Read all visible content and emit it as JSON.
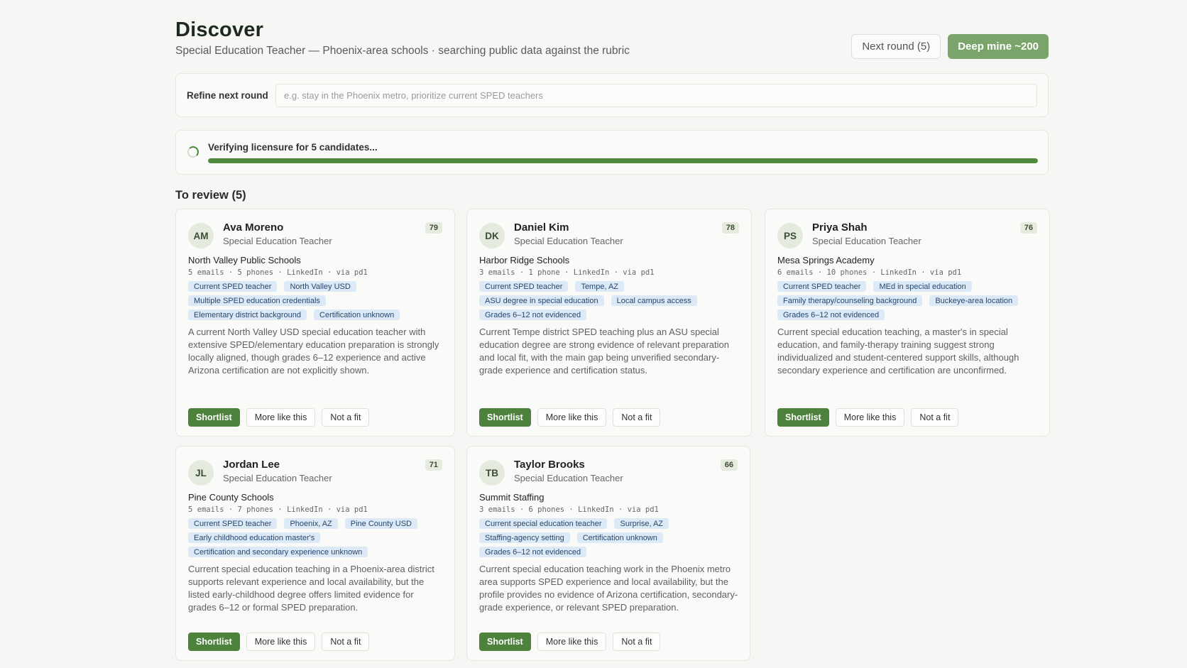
{
  "header": {
    "title": "Discover",
    "subtitle": "Special Education Teacher — Phoenix-area schools · searching public data against the rubric",
    "next_round_label": "Next round (5)",
    "deep_mine_label": "Deep mine ~200"
  },
  "refine": {
    "label": "Refine next round",
    "placeholder": "e.g. stay in the Phoenix metro, prioritize current SPED teachers"
  },
  "progress": {
    "text": "Verifying licensure for 5 candidates...",
    "percent": 100
  },
  "review": {
    "title": "To review (5)",
    "actions": {
      "shortlist": "Shortlist",
      "more_like": "More like this",
      "not_fit": "Not a fit"
    },
    "candidates": [
      {
        "initials": "AM",
        "name": "Ava Moreno",
        "role": "Special Education Teacher",
        "score": "79",
        "org": "North Valley Public Schools",
        "meta": "5 emails · 5 phones · LinkedIn · via pd1",
        "tags": [
          "Current SPED teacher",
          "North Valley USD",
          "Multiple SPED education credentials",
          "Elementary district background",
          "Certification unknown"
        ],
        "summary": "A current North Valley USD special education teacher with extensive SPED/elementary education preparation is strongly locally aligned, though grades 6–12 experience and active Arizona certification are not explicitly shown."
      },
      {
        "initials": "DK",
        "name": "Daniel Kim",
        "role": "Special Education Teacher",
        "score": "78",
        "org": "Harbor Ridge Schools",
        "meta": "3 emails · 1 phone · LinkedIn · via pd1",
        "tags": [
          "Current SPED teacher",
          "Tempe, AZ",
          "ASU degree in special education",
          "Local campus access",
          "Grades 6–12 not evidenced"
        ],
        "summary": "Current Tempe district SPED teaching plus an ASU special education degree are strong evidence of relevant preparation and local fit, with the main gap being unverified secondary-grade experience and certification status."
      },
      {
        "initials": "PS",
        "name": "Priya Shah",
        "role": "Special Education Teacher",
        "score": "76",
        "org": "Mesa Springs Academy",
        "meta": "6 emails · 10 phones · LinkedIn · via pd1",
        "tags": [
          "Current SPED teacher",
          "MEd in special education",
          "Family therapy/counseling background",
          "Buckeye-area location",
          "Grades 6–12 not evidenced"
        ],
        "summary": "Current special education teaching, a master's in special education, and family-therapy training suggest strong individualized and student-centered support skills, although secondary experience and certification are unconfirmed."
      },
      {
        "initials": "JL",
        "name": "Jordan Lee",
        "role": "Special Education Teacher",
        "score": "71",
        "org": "Pine County Schools",
        "meta": "5 emails · 7 phones · LinkedIn · via pd1",
        "tags": [
          "Current SPED teacher",
          "Phoenix, AZ",
          "Pine County USD",
          "Early childhood education master's",
          "Certification and secondary experience unknown"
        ],
        "summary": "Current special education teaching in a Phoenix-area district supports relevant experience and local availability, but the listed early-childhood degree offers limited evidence for grades 6–12 or formal SPED preparation."
      },
      {
        "initials": "TB",
        "name": "Taylor Brooks",
        "role": "Special Education Teacher",
        "score": "66",
        "org": "Summit Staffing",
        "meta": "3 emails · 6 phones · LinkedIn · via pd1",
        "tags": [
          "Current special education teacher",
          "Surprise, AZ",
          "Staffing-agency setting",
          "Certification unknown",
          "Grades 6–12 not evidenced"
        ],
        "summary": "Current special education teaching work in the Phoenix metro area supports SPED experience and local availability, but the profile provides no evidence of Arizona certification, secondary-grade experience, or relevant SPED preparation."
      }
    ]
  }
}
